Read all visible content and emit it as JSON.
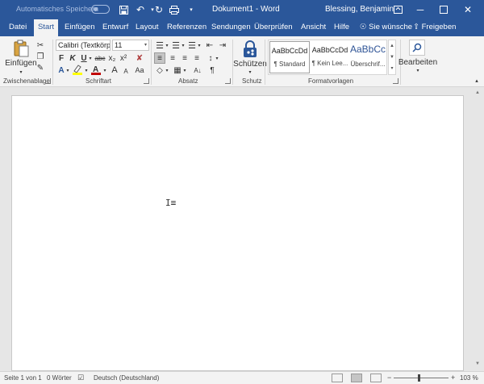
{
  "titlebar": {
    "autosave_label": "Automatisches Speichern",
    "autosave_state": "off",
    "document_title": "Dokument1 - Word",
    "user_name": "Blessing, Benjamin",
    "accent_color": "#2b579a"
  },
  "tabs": [
    {
      "label": "Datei",
      "active": false
    },
    {
      "label": "Start",
      "active": true
    },
    {
      "label": "Einfügen",
      "active": false
    },
    {
      "label": "Entwurf",
      "active": false
    },
    {
      "label": "Layout",
      "active": false
    },
    {
      "label": "Referenzen",
      "active": false
    },
    {
      "label": "Sendungen",
      "active": false
    },
    {
      "label": "Überprüfen",
      "active": false
    },
    {
      "label": "Ansicht",
      "active": false
    },
    {
      "label": "Hilfe",
      "active": false
    }
  ],
  "tell_me": "Sie wünsche",
  "share_label": "Freigeben",
  "ribbon": {
    "clipboard": {
      "paste_label": "Einfügen",
      "group_label": "Zwischenablage"
    },
    "font": {
      "font_name": "Calibri (Textkörp•",
      "font_size": "11",
      "group_label": "Schriftart",
      "bold": "F",
      "italic": "K",
      "underline": "U",
      "strike": "abc",
      "sub": "x₂",
      "sup": "x²",
      "grow": "A",
      "shrink": "A",
      "highlight_color": "#ffff00",
      "font_color": "#c00000"
    },
    "paragraph": {
      "group_label": "Absatz",
      "show_marks": "¶"
    },
    "protect": {
      "label": "Schützen",
      "group_label": "Schutz"
    },
    "styles": {
      "group_label": "Formatvorlagen",
      "items": [
        {
          "sample": "AaBbCcDd",
          "name": "¶ Standard",
          "selected": true
        },
        {
          "sample": "AaBbCcDd",
          "name": "¶ Kein Lee...",
          "selected": false
        },
        {
          "sample": "AaBbCc",
          "name": "Überschrif...",
          "selected": false
        }
      ]
    },
    "editing": {
      "label": "Bearbeiten"
    }
  },
  "statusbar": {
    "page": "Seite 1 von 1",
    "words": "0 Wörter",
    "language": "Deutsch (Deutschland)",
    "zoom_minus": "−",
    "zoom_plus": "+",
    "zoom": "103 %"
  }
}
